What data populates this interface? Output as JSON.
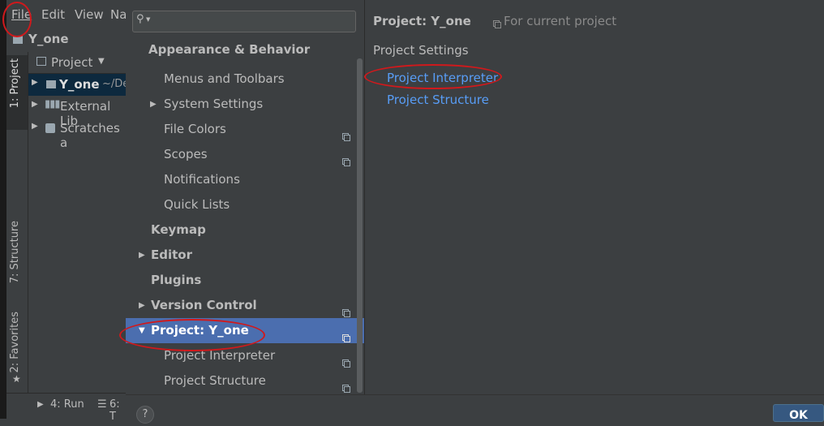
{
  "ide": {
    "menu": [
      "File",
      "Edit",
      "View",
      "Na"
    ],
    "breadcrumb": "Y_one",
    "tool_tabs": {
      "project": "1: Project",
      "structure": "7: Structure",
      "favorites": "2: Favorites"
    },
    "project_panel": {
      "header": "Project",
      "items": [
        {
          "name": "Y_one",
          "path": "~/De"
        },
        {
          "name": "External Lib"
        },
        {
          "name": "Scratches a"
        }
      ]
    },
    "statusbar": {
      "run": "4: Run",
      "todo": "6: T"
    }
  },
  "settings": {
    "search_placeholder": "",
    "tree": [
      {
        "label": "Appearance & Behavior",
        "bold": true
      },
      {
        "label": "Menus and Toolbars"
      },
      {
        "label": "System Settings"
      },
      {
        "label": "File Colors"
      },
      {
        "label": "Scopes"
      },
      {
        "label": "Notifications"
      },
      {
        "label": "Quick Lists"
      },
      {
        "label": "Keymap",
        "bold": true
      },
      {
        "label": "Editor",
        "bold": true
      },
      {
        "label": "Plugins",
        "bold": true
      },
      {
        "label": "Version Control",
        "bold": true
      },
      {
        "label": "Project: Y_one",
        "bold": true,
        "selected": true
      },
      {
        "label": "Project Interpreter"
      },
      {
        "label": "Project Structure"
      }
    ],
    "right": {
      "title": "Project: Y_one",
      "scope_note": "For current project",
      "section": "Project Settings",
      "links": [
        "Project Interpreter",
        "Project Structure"
      ]
    },
    "footer": {
      "help": "?",
      "ok": "OK"
    }
  },
  "colors": {
    "selection": "#4b6eaf",
    "link": "#589df6",
    "annotation": "#d0191c"
  }
}
